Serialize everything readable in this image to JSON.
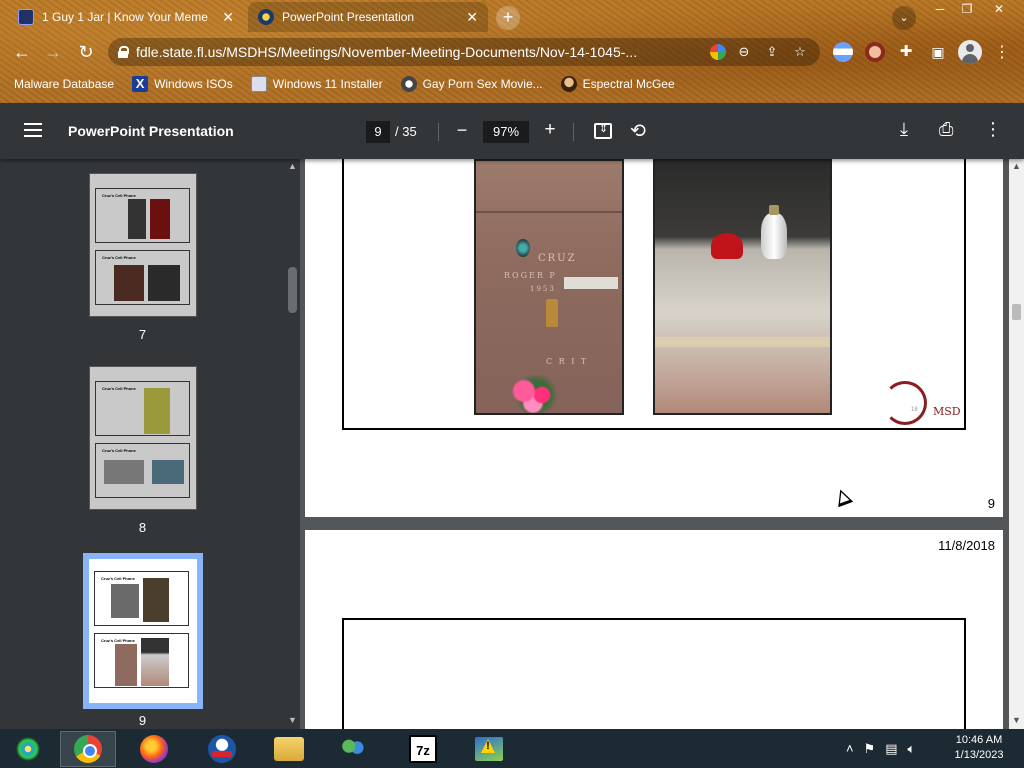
{
  "browser": {
    "tabs": [
      {
        "title": "1 Guy 1 Jar | Know Your Meme",
        "active": false
      },
      {
        "title": "PowerPoint Presentation",
        "active": true
      }
    ],
    "new_tab_label": "+",
    "url": "fdle.state.fl.us/MSDHS/Meetings/November-Meeting-Documents/Nov-14-1045-...",
    "bookmarks": [
      {
        "label": "Malware Database",
        "icon": "blank-icon"
      },
      {
        "label": "Windows ISOs",
        "icon": "windows-x-icon"
      },
      {
        "label": "Windows 11 Installer",
        "icon": "installer-icon"
      },
      {
        "label": "Gay Porn Sex Movie...",
        "icon": "site-icon"
      },
      {
        "label": "Espectral McGee",
        "icon": "avatar-icon"
      }
    ],
    "theme_color": "#b07024"
  },
  "pdf": {
    "title": "PowerPoint Presentation",
    "current_page": "9",
    "total_pages": "/ 35",
    "zoom": "97%",
    "thumbnails": [
      {
        "label": "7",
        "slide_title": "Cruz's Cell Phone"
      },
      {
        "label": "8",
        "slide_title": "Cruz's Cell Phone"
      },
      {
        "label": "9",
        "slide_title": "Cruz's Cell Phone",
        "selected": true
      }
    ],
    "page_a": {
      "page_number": "9",
      "engraving": {
        "name": "CRUZ",
        "first": "ROGER P",
        "line2": "1953",
        "bottom": "C R I T"
      },
      "logo_text": "MSD",
      "logo_number": "18"
    },
    "page_b": {
      "date": "11/8/2018"
    }
  },
  "taskbar": {
    "apps": [
      "start",
      "chrome",
      "firefox",
      "obama-site",
      "file-explorer",
      "people",
      "7zip",
      "warning-app"
    ],
    "clock_time": "10:46 AM",
    "clock_date": "1/13/2023"
  }
}
